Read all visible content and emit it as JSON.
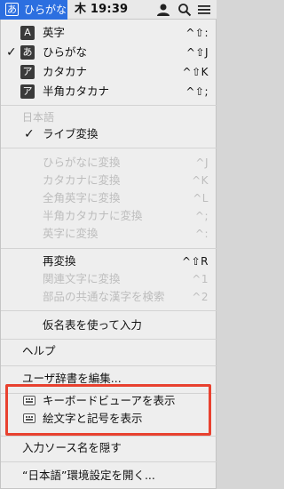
{
  "menubar": {
    "input_glyph": "あ",
    "input_name": "ひらがな",
    "clock": "木 19:39",
    "icons": [
      "user-icon",
      "search-icon",
      "list-icon"
    ]
  },
  "input_sources": [
    {
      "glyph": "A",
      "label": "英字",
      "shortcut": "^⇧:"
    },
    {
      "glyph": "あ",
      "label": "ひらがな",
      "shortcut": "^⇧J",
      "checked": "✓"
    },
    {
      "glyph": "ア",
      "label": "カタカナ",
      "shortcut": "^⇧K"
    },
    {
      "glyph": "ア",
      "label": "半角カタカナ",
      "shortcut": "^⇧;"
    }
  ],
  "japanese_section": {
    "title": "日本語",
    "live_conversion": {
      "check": "✓",
      "label": "ライブ変換"
    },
    "convert_items": [
      {
        "label": "ひらがなに変換",
        "shortcut": "^J"
      },
      {
        "label": "カタカナに変換",
        "shortcut": "^K"
      },
      {
        "label": "全角英字に変換",
        "shortcut": "^L"
      },
      {
        "label": "半角カタカナに変換",
        "shortcut": "^;"
      },
      {
        "label": "英字に変換",
        "shortcut": "^:"
      }
    ],
    "reconvert": {
      "label": "再変換",
      "shortcut": "^⇧R"
    },
    "related": {
      "label": "関連文字に変換",
      "shortcut": "^1"
    },
    "common_kanji": {
      "label": "部品の共通な漢字を検索",
      "shortcut": "^2"
    },
    "kana_table": "仮名表を使って入力"
  },
  "help": "ヘルプ",
  "user_dict": "ユーザ辞書を編集...",
  "keyboard_viewer": "キーボードビューアを表示",
  "emoji": "絵文字と記号を表示",
  "hide_source_name": "入力ソース名を隠す",
  "open_prefs": "“日本語”環境設定を開く...",
  "colors": {
    "accent": "#2c6fe0",
    "highlight": "#e8412f"
  }
}
